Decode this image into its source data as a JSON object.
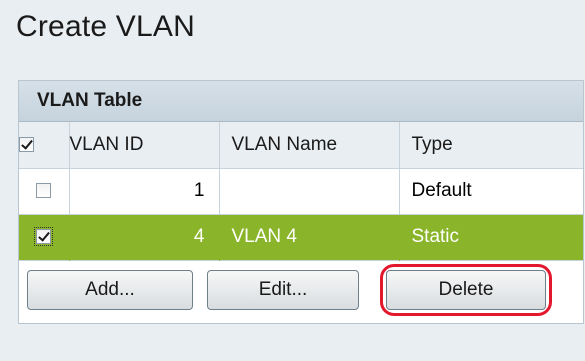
{
  "page": {
    "title": "Create VLAN"
  },
  "panel": {
    "header": "VLAN Table"
  },
  "table": {
    "columns": [
      "VLAN ID",
      "VLAN Name",
      "Type"
    ],
    "header_checkbox_checked": true,
    "rows": [
      {
        "checked": false,
        "vlan_id": "1",
        "vlan_name": "",
        "type": "Default",
        "selected": false
      },
      {
        "checked": true,
        "vlan_id": "4",
        "vlan_name": "VLAN 4",
        "type": "Static",
        "selected": true
      }
    ]
  },
  "buttons": {
    "add": "Add...",
    "edit": "Edit...",
    "delete": "Delete"
  },
  "colors": {
    "selected_row": "#8ab52a",
    "highlight_ring": "#e3182d",
    "panel_header": "#c6d3dd"
  }
}
